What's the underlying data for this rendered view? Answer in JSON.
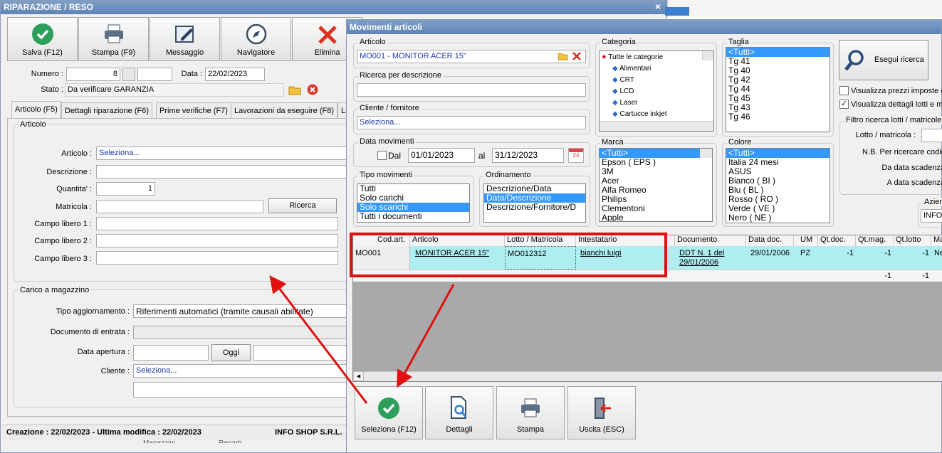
{
  "back_window": {
    "title": "RIPARAZIONE / RESO",
    "close": "×",
    "toolbar": [
      {
        "label": "Salva (F12)",
        "icon": "check-icon"
      },
      {
        "label": "Stampa (F9)",
        "icon": "printer-icon"
      },
      {
        "label": "Messaggio",
        "icon": "message-icon"
      },
      {
        "label": "Navigatore",
        "icon": "compass-icon"
      },
      {
        "label": "Elimina",
        "icon": "delete-icon"
      }
    ],
    "numero_label": "Numero :",
    "numero_value": "8",
    "data_label": "Data :",
    "data_value": "22/02/2023",
    "stato_label": "Stato :",
    "stato_value": "Da verificare GARANZIA",
    "tabs": [
      "Articolo (F5)",
      "Dettagli riparazione (F6)",
      "Prime verifiche (F7)",
      "Lavorazioni da eseguire (F8)",
      "La"
    ],
    "articolo_group": "Articolo",
    "articolo_label": "Articolo :",
    "articolo_value": "Seleziona...",
    "descrizione_label": "Descrizione :",
    "quantita_label": "Quantita' :",
    "quantita_value": "1",
    "matricola_label": "Matricola :",
    "ricerca_button": "Ricerca",
    "campo1_label": "Campo libero 1 :",
    "campo2_label": "Campo libero 2 :",
    "campo3_label": "Campo libero 3 :",
    "carico_group": "Carico a magazzino",
    "tipo_label": "Tipo aggiornamento :",
    "tipo_value": "Riferimenti automatici (tramite causali abilitate)",
    "documento_label": "Documento di entrata :",
    "apertura_label": "Data apertura :",
    "oggi_button": "Oggi",
    "cliente_label": "Cliente :",
    "cliente_value": "Seleziona...",
    "status_left": "Creazione : 22/02/2023 - Ultima modifica : 22/02/2023",
    "status_right": "INFO SHOP S.R.L.",
    "bottom_cut": [
      "Magazzini",
      "Reparti"
    ]
  },
  "front_window": {
    "title": "Movimenti articoli",
    "articolo_group": "Articolo",
    "articolo_value": "MO001 - MONITOR ACER 15\"",
    "ricerca_desc_group": "Ricerca per descrizione",
    "cliente_group": "Cliente / fornitore",
    "cliente_value": "Seleziona...",
    "data_mov_group": "Data movimenti",
    "dal_label": "Dal",
    "dal_value": "01/01/2023",
    "al_label": "al",
    "al_value": "31/12/2023",
    "calendar_day": "24",
    "tipo_mov_group": "Tipo movimenti",
    "tipo_mov_items": [
      "Tutti",
      "Solo carichi",
      "Solo scarichi",
      "Tutti i documenti"
    ],
    "tipo_mov_selected": 2,
    "ordinamento_group": "Ordinamento",
    "ordinamento_items": [
      "Descrizione/Data",
      "Data/Descrizione",
      "Descrizione/Fornitore/D"
    ],
    "ordinamento_selected": 1,
    "categoria_group": "Categoria",
    "categoria_items": [
      "Tutte le categorie",
      "Alimentari",
      "CRT",
      "LCD",
      "Laser",
      "Cartucce inkjet"
    ],
    "taglia_group": "Taglia",
    "taglia_items": [
      "<Tutti>",
      "Tg 41",
      "Tg 40",
      "Tg 42",
      "Tg 44",
      "Tg 45",
      "Tg 43",
      "Tg 46"
    ],
    "marca_group": "Marca",
    "marca_items": [
      "<Tutti>",
      "Epson ( EPS )",
      "3M",
      "Acer",
      "Alfa Romeo",
      "Philips",
      "Clementoni",
      "Apple"
    ],
    "colore_group": "Colore",
    "colore_items": [
      "<Tutti>",
      "Italia 24 mesi",
      "ASUS",
      "Bianco ( BI )",
      "Blu ( BL )",
      "Rosso ( RO )",
      "Verde ( VE )",
      "Nero ( NE )"
    ],
    "esegui_button": "Esegui ricerca",
    "visualizza_prezzi": "Visualizza prezzi imposte co",
    "visualizza_prezzi_checked": false,
    "visualizza_dettagli": "Visualizza dettagli lotti e ma",
    "visualizza_dettagli_checked": true,
    "filtro_group": "Filtro ricerca lotti / matricole",
    "lotto_label": "Lotto / matricola :",
    "nb_label": "N.B. Per ricercare codici par",
    "da_scad_label": "Da data scadenza",
    "a_scad_label": "A data scadenza",
    "azienda_group": "Azienc",
    "azienda_value": "INFO",
    "grid_headers": [
      "Cod.art.",
      "Articolo",
      "Lotto / Matricola",
      "Intestatario",
      "Documento",
      "Data doc.",
      "UM",
      "Qt.doc.",
      "Qt.mag.",
      "Qt.lotto",
      "Ma"
    ],
    "grid_row": {
      "cod": "MO001",
      "articolo": "MONITOR ACER 15\"",
      "lotto": "MO012312",
      "intestatario": "bianchi luigi",
      "documento": "DDT N. 1 del 29/01/2006",
      "data_doc": "29/01/2006",
      "um": "PZ",
      "qt_doc": "-1",
      "qt_mag": "-1",
      "qt_lotto": "-1",
      "ma": "Ne"
    },
    "grid_totals": {
      "qt_mag": "-1",
      "qt_lotto": "-1"
    },
    "bottom_buttons": [
      {
        "label": "Seleziona (F12)",
        "icon": "check-icon"
      },
      {
        "label": "Dettagli",
        "icon": "magnifier-document-icon"
      },
      {
        "label": "Stampa",
        "icon": "printer-icon"
      },
      {
        "label": "Uscita (ESC)",
        "icon": "exit-icon"
      }
    ]
  },
  "colors": {
    "highlight_box": "#e01010",
    "annotation_arrow": "#e01010",
    "title_bar": "#6a8dbf",
    "row_highlight": "#aeeef0",
    "selection": "#3399ff"
  }
}
